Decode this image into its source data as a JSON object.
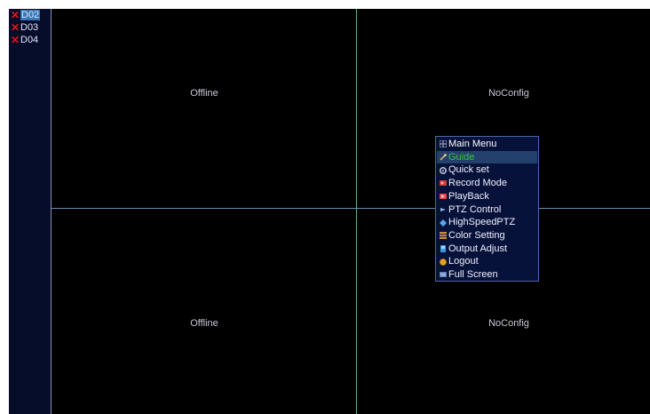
{
  "channels": [
    {
      "label": "D02",
      "status_icon": "x-icon",
      "selected": true
    },
    {
      "label": "D03",
      "status_icon": "x-icon",
      "selected": false
    },
    {
      "label": "D04",
      "status_icon": "x-icon",
      "selected": false
    }
  ],
  "quadrants": {
    "top_left": "Offline",
    "top_right": "NoConfig",
    "bottom_left": "Offline",
    "bottom_right": "NoConfig"
  },
  "menu": {
    "title": "Main Menu",
    "items": [
      {
        "label": "Guide",
        "icon": "wand-icon",
        "highlighted": true
      },
      {
        "label": "Quick set",
        "icon": "gear-icon"
      },
      {
        "label": "Record Mode",
        "icon": "record-icon"
      },
      {
        "label": "PlayBack",
        "icon": "playback-icon"
      },
      {
        "label": "PTZ Control",
        "icon": "ptz-icon"
      },
      {
        "label": "HighSpeedPTZ",
        "icon": "highspeed-ptz-icon"
      },
      {
        "label": "Color Setting",
        "icon": "color-setting-icon"
      },
      {
        "label": "Output Adjust",
        "icon": "output-adjust-icon"
      },
      {
        "label": "Logout",
        "icon": "logout-icon"
      },
      {
        "label": "Full Screen",
        "icon": "fullscreen-icon"
      }
    ]
  },
  "colors": {
    "screen_bg": "#000000",
    "sidebar_bg": "#050d2a",
    "menu_bg": "#07123a",
    "highlight_text": "#38c43c",
    "offline_x": "#e01818"
  }
}
